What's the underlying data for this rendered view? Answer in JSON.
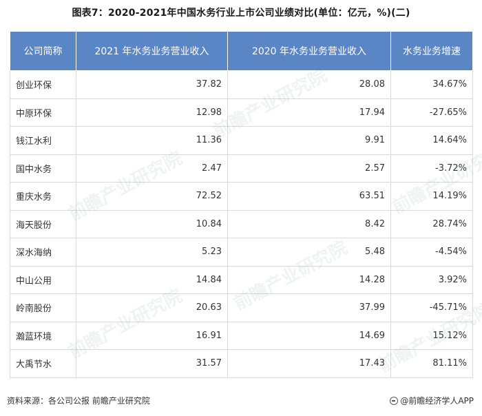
{
  "title": "图表7：2020-2021年中国水务行业上市公司业绩对比(单位：亿元，%)(二)",
  "table": {
    "headers": [
      "公司简称",
      "2021 年水务业务营业收入",
      "2020 年水务业务营业收入",
      "水务业务增速"
    ],
    "rows": [
      [
        "创业环保",
        "37.82",
        "28.08",
        "34.67%"
      ],
      [
        "中原环保",
        "12.98",
        "17.94",
        "-27.65%"
      ],
      [
        "钱江水利",
        "11.36",
        "9.91",
        "14.64%"
      ],
      [
        "国中水务",
        "2.47",
        "2.57",
        "-3.72%"
      ],
      [
        "重庆水务",
        "72.52",
        "63.51",
        "14.19%"
      ],
      [
        "海天股份",
        "10.84",
        "8.42",
        "28.74%"
      ],
      [
        "深水海纳",
        "5.23",
        "5.48",
        "-4.54%"
      ],
      [
        "中山公用",
        "14.84",
        "14.28",
        "3.92%"
      ],
      [
        "岭南股份",
        "20.63",
        "37.99",
        "-45.71%"
      ],
      [
        "瀚蓝环境",
        "16.91",
        "14.69",
        "15.12%"
      ],
      [
        "大禹节水",
        "31.57",
        "17.43",
        "81.11%"
      ]
    ]
  },
  "footer": {
    "source": "资料来源：各公司公报 前瞻产业研究院",
    "brand": "@前瞻经济学人APP"
  },
  "watermark": "前瞻产业研究院",
  "colors": {
    "header_bg": "#5b86c5",
    "header_text": "#ffffff",
    "border": "#d9d9d9"
  }
}
